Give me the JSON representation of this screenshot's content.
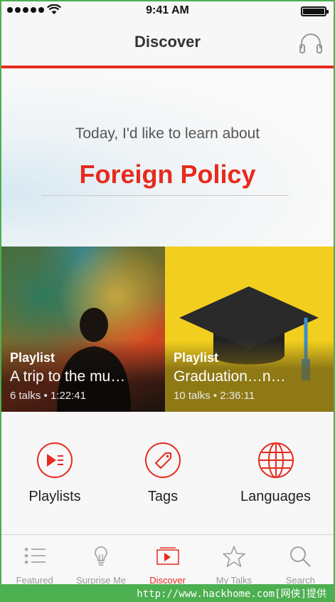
{
  "status_bar": {
    "time": "9:41 AM"
  },
  "nav": {
    "title": "Discover",
    "right_icon": "headphones-icon"
  },
  "hero": {
    "prompt": "Today, I'd like to learn about",
    "topic": "Foreign Policy"
  },
  "cards": [
    {
      "kind": "Playlist",
      "title": "A trip to the mu…",
      "meta": "6 talks • 1:22:41"
    },
    {
      "kind": "Playlist",
      "title": "Graduation…n…",
      "meta": "10 talks • 2:36:11"
    }
  ],
  "browse": [
    {
      "label": "Playlists",
      "icon": "playlist-icon"
    },
    {
      "label": "Tags",
      "icon": "tag-icon"
    },
    {
      "label": "Languages",
      "icon": "globe-icon"
    }
  ],
  "tabs": [
    {
      "label": "Featured",
      "icon": "list-icon",
      "active": false
    },
    {
      "label": "Surprise Me",
      "icon": "lightbulb-icon",
      "active": false
    },
    {
      "label": "Discover",
      "icon": "discover-icon",
      "active": true
    },
    {
      "label": "My Talks",
      "icon": "star-icon",
      "active": false
    },
    {
      "label": "Search",
      "icon": "search-icon",
      "active": false
    }
  ],
  "footer": {
    "text": "http://www.hackhome.com[网侠]提供"
  },
  "colors": {
    "accent": "#e62b1e",
    "card_b_bg": "#f2cf1e"
  }
}
